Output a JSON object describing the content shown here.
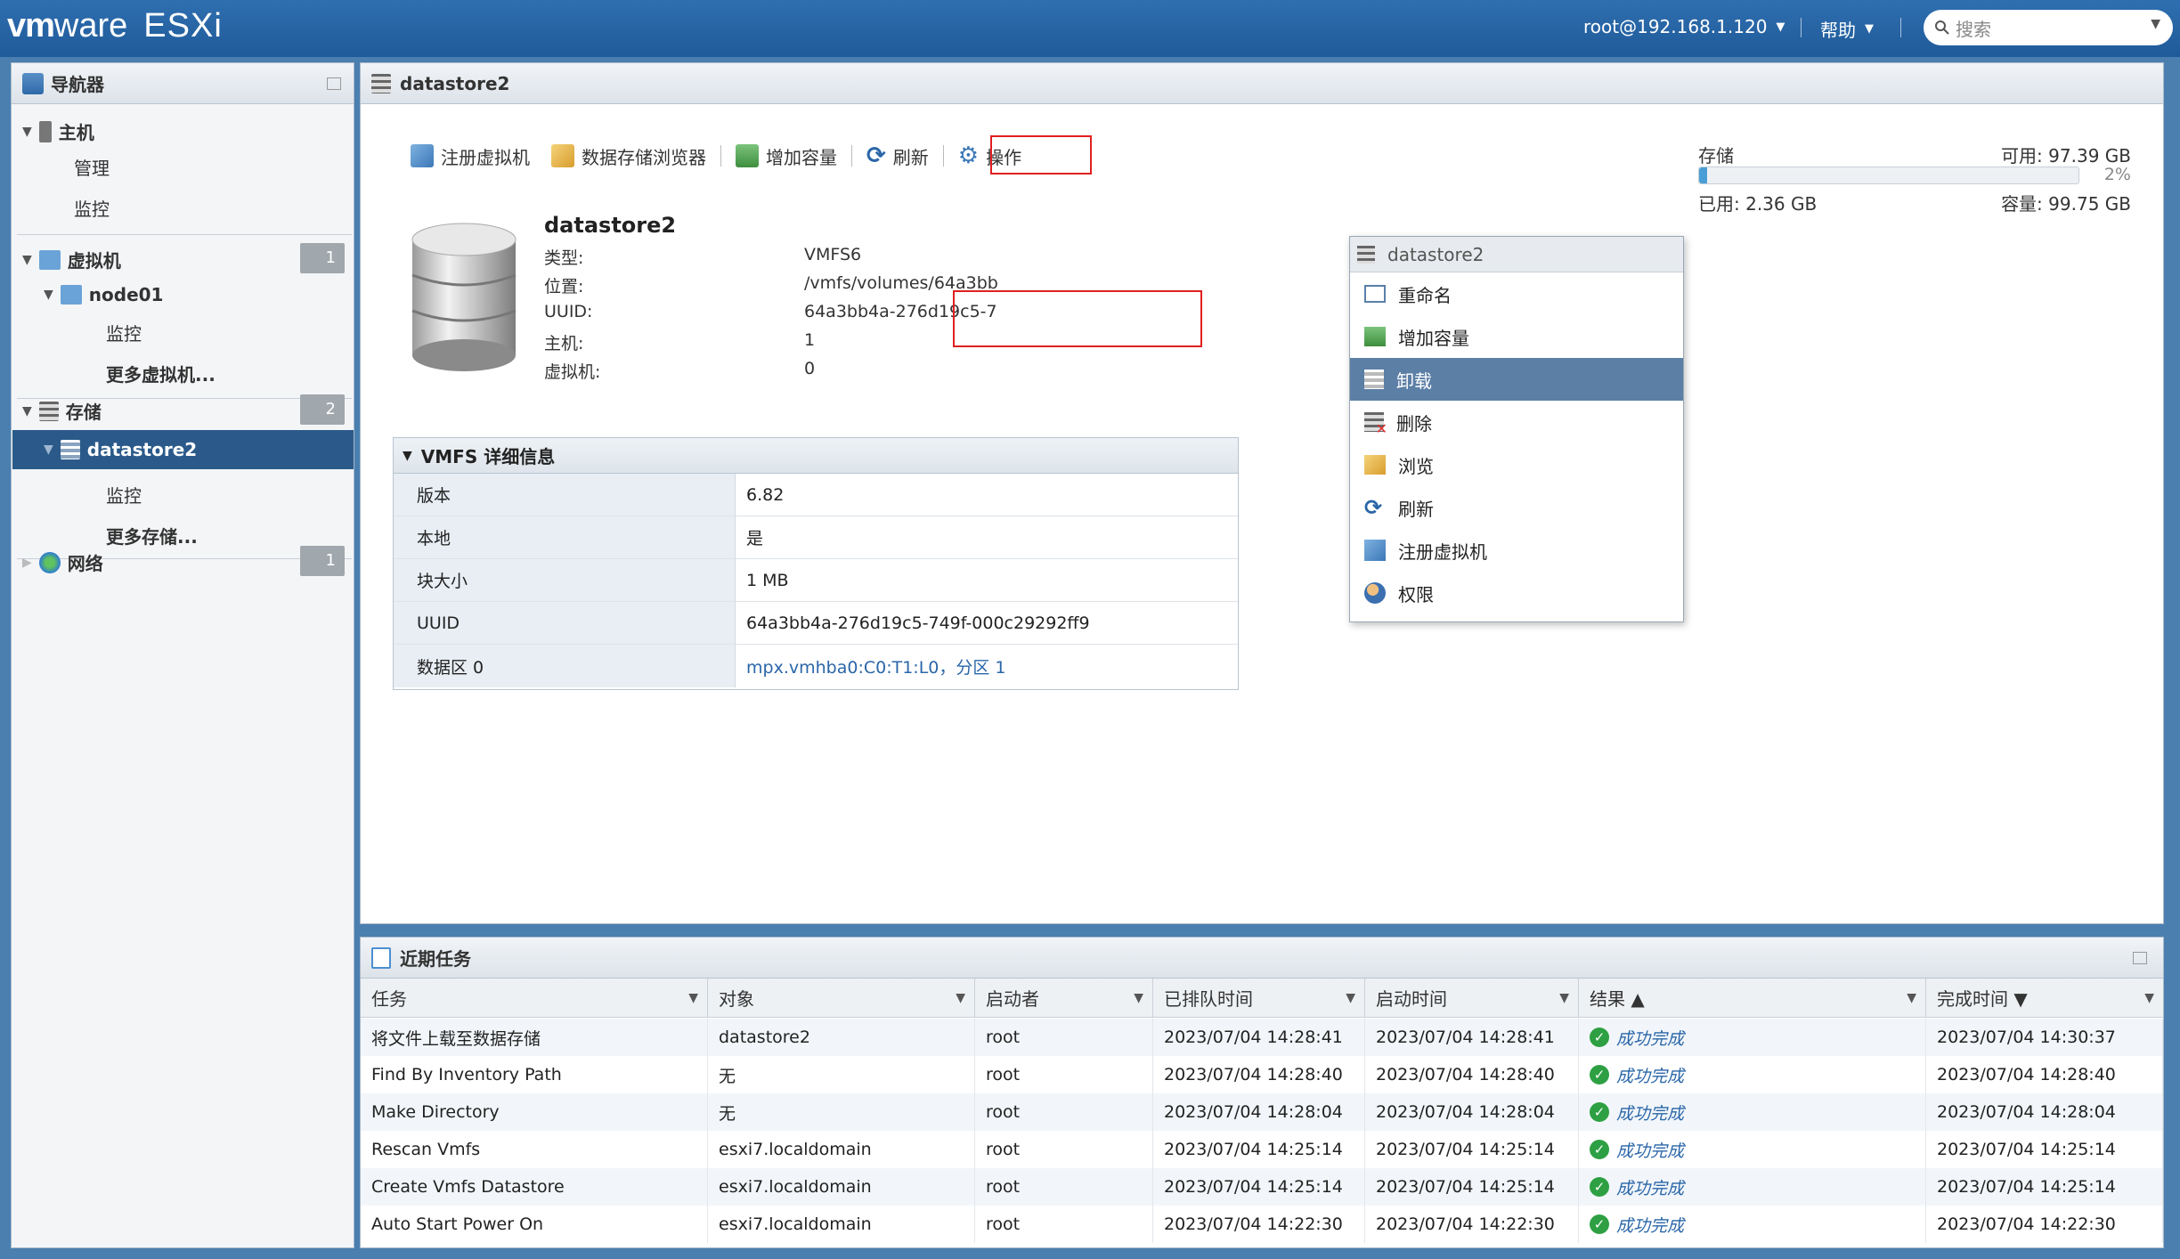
{
  "header": {
    "brand_vm": "vm",
    "brand_ware": "ware",
    "brand_product": "ESXi",
    "user": "root@192.168.1.120",
    "help": "帮助",
    "search_placeholder": "搜索"
  },
  "navigator": {
    "title": "导航器",
    "host": "主机",
    "host_manage": "管理",
    "host_monitor": "监控",
    "vms": "虚拟机",
    "vms_count": "1",
    "node": "node01",
    "node_monitor": "监控",
    "more_vms": "更多虚拟机...",
    "storage": "存储",
    "storage_count": "2",
    "datastore": "datastore2",
    "ds_monitor": "监控",
    "more_storage": "更多存储...",
    "network": "网络",
    "network_count": "1"
  },
  "main": {
    "title": "datastore2",
    "toolbar": {
      "register_vm": "注册虚拟机",
      "browser": "数据存储浏览器",
      "increase": "增加容量",
      "refresh": "刷新",
      "actions": "操作"
    },
    "ds_name": "datastore2",
    "info": [
      {
        "k": "类型:",
        "v": "VMFS6"
      },
      {
        "k": "位置:",
        "v": "/vmfs/volumes/64a3bb"
      },
      {
        "k": "UUID:",
        "v": "64a3bb4a-276d19c5-7"
      },
      {
        "k": "主机:",
        "v": "1"
      },
      {
        "k": "虚拟机:",
        "v": "0"
      }
    ],
    "storage": {
      "label": "存储",
      "free": "可用: 97.39 GB",
      "percent": "2%",
      "used": "已用: 2.36 GB",
      "capacity": "容量: 99.75 GB",
      "used_fraction": 0.02
    },
    "vmfs": {
      "title": "VMFS 详细信息",
      "rows": [
        {
          "k": "版本",
          "v": "6.82"
        },
        {
          "k": "本地",
          "v": "是"
        },
        {
          "k": "块大小",
          "v": "1 MB"
        },
        {
          "k": "UUID",
          "v": "64a3bb4a-276d19c5-749f-000c29292ff9"
        },
        {
          "k": "数据区 0",
          "v": "mpx.vmhba0:C0:T1:L0，分区 1"
        }
      ]
    }
  },
  "actions_menu": {
    "header": "datastore2",
    "items": [
      "重命名",
      "增加容量",
      "卸载",
      "删除",
      "浏览",
      "刷新",
      "注册虚拟机",
      "权限"
    ]
  },
  "tasks": {
    "title": "近期任务",
    "columns": [
      "任务",
      "对象",
      "启动者",
      "已排队时间",
      "启动时间",
      "结果 ▲",
      "完成时间 ▼"
    ],
    "rows": [
      [
        "将文件上载至数据存储",
        "datastore2",
        "root",
        "2023/07/04 14:28:41",
        "2023/07/04 14:28:41",
        "成功完成",
        "2023/07/04 14:30:37"
      ],
      [
        "Find By Inventory Path",
        "无",
        "root",
        "2023/07/04 14:28:40",
        "2023/07/04 14:28:40",
        "成功完成",
        "2023/07/04 14:28:40"
      ],
      [
        "Make Directory",
        "无",
        "root",
        "2023/07/04 14:28:04",
        "2023/07/04 14:28:04",
        "成功完成",
        "2023/07/04 14:28:04"
      ],
      [
        "Rescan Vmfs",
        "esxi7.localdomain",
        "root",
        "2023/07/04 14:25:14",
        "2023/07/04 14:25:14",
        "成功完成",
        "2023/07/04 14:25:14"
      ],
      [
        "Create Vmfs Datastore",
        "esxi7.localdomain",
        "root",
        "2023/07/04 14:25:14",
        "2023/07/04 14:25:14",
        "成功完成",
        "2023/07/04 14:25:14"
      ],
      [
        "Auto Start Power On",
        "esxi7.localdomain",
        "root",
        "2023/07/04 14:22:30",
        "2023/07/04 14:22:30",
        "成功完成",
        "2023/07/04 14:22:30"
      ]
    ]
  }
}
